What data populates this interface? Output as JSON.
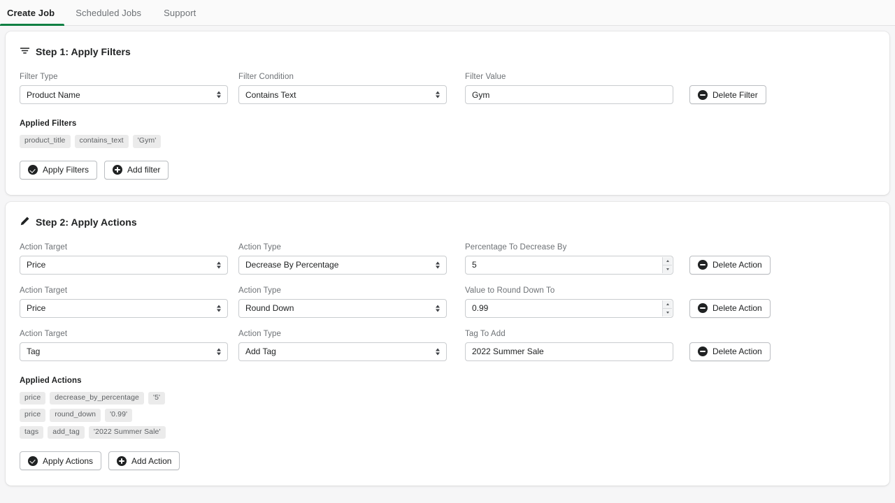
{
  "theme": {
    "accent": "#108043",
    "page_bg": "#f6f6f7",
    "chip_bg": "#ebebeb"
  },
  "tabs": [
    {
      "label": "Create Job",
      "active": true
    },
    {
      "label": "Scheduled Jobs",
      "active": false
    },
    {
      "label": "Support",
      "active": false
    }
  ],
  "step1": {
    "icon": "filter-icon",
    "title": "Step 1: Apply Filters",
    "filter_row": {
      "filter_type": {
        "label": "Filter Type",
        "value": "Product Name"
      },
      "filter_condition": {
        "label": "Filter Condition",
        "value": "Contains Text"
      },
      "filter_value": {
        "label": "Filter Value",
        "value": "Gym",
        "placeholder": "Filter Value"
      },
      "delete_label": "Delete Filter"
    },
    "applied_title": "Applied Filters",
    "applied": [
      [
        "product_title",
        "contains_text",
        "'Gym'"
      ]
    ],
    "apply_label": "Apply Filters",
    "add_label": "Add filter"
  },
  "step2": {
    "icon": "pencil-icon",
    "title": "Step 2: Apply Actions",
    "rows": [
      {
        "target": {
          "label": "Action Target",
          "value": "Price"
        },
        "type": {
          "label": "Action Type",
          "value": "Decrease By Percentage"
        },
        "value": {
          "label": "Percentage To Decrease By",
          "value": "5",
          "kind": "number"
        },
        "delete_label": "Delete Action"
      },
      {
        "target": {
          "label": "Action Target",
          "value": "Price"
        },
        "type": {
          "label": "Action Type",
          "value": "Round Down"
        },
        "value": {
          "label": "Value to Round Down To",
          "value": "0.99",
          "kind": "number"
        },
        "delete_label": "Delete Action"
      },
      {
        "target": {
          "label": "Action Target",
          "value": "Tag"
        },
        "type": {
          "label": "Action Type",
          "value": "Add Tag"
        },
        "value": {
          "label": "Tag To Add",
          "value": "2022 Summer Sale",
          "kind": "text"
        },
        "delete_label": "Delete Action"
      }
    ],
    "applied_title": "Applied Actions",
    "applied": [
      [
        "price",
        "decrease_by_percentage",
        "'5'"
      ],
      [
        "price",
        "round_down",
        "'0.99'"
      ],
      [
        "tags",
        "add_tag",
        "'2022 Summer Sale'"
      ]
    ],
    "apply_label": "Apply Actions",
    "add_label": "Add Action"
  }
}
